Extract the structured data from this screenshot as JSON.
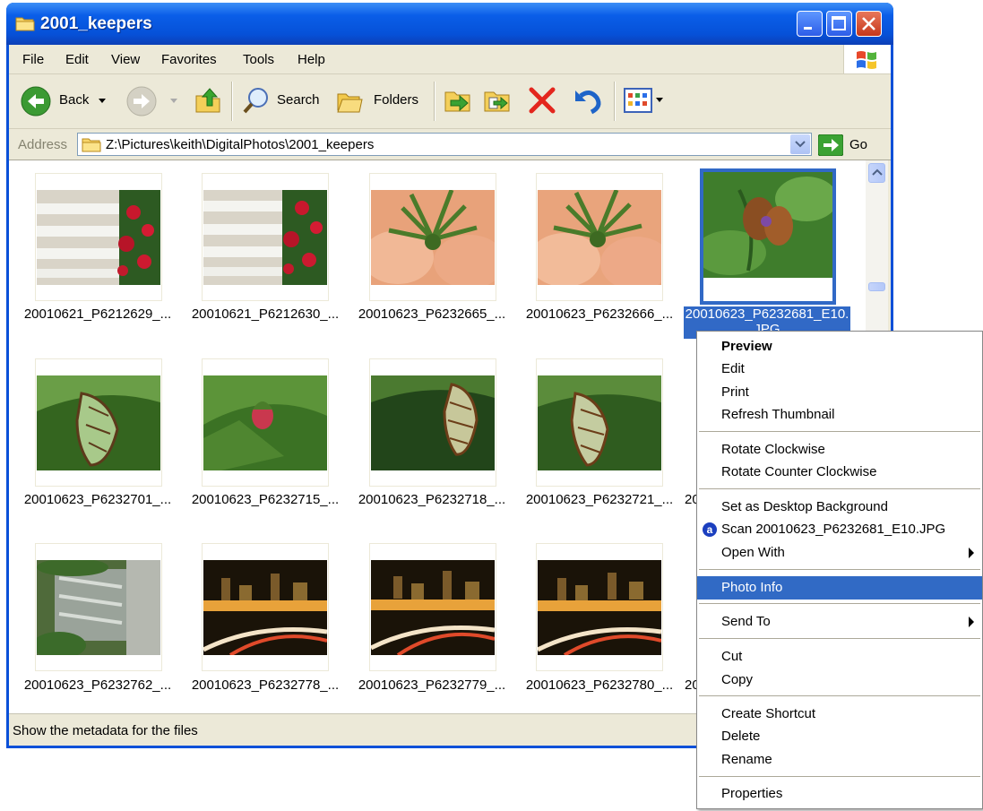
{
  "window": {
    "title": "2001_keepers",
    "title_icon": "folder-icon"
  },
  "menubar": {
    "items": [
      "File",
      "Edit",
      "View",
      "Favorites",
      "Tools",
      "Help"
    ]
  },
  "toolbar": {
    "back_label": "Back",
    "search_label": "Search",
    "folders_label": "Folders"
  },
  "addressbar": {
    "label": "Address",
    "path": "Z:\\Pictures\\keith\\DigitalPhotos\\2001_keepers",
    "go_label": "Go"
  },
  "thumbnails": [
    {
      "caption": "20010621_P6212629_...",
      "subject": "white fence with red flowers"
    },
    {
      "caption": "20010621_P6212630_...",
      "subject": "white fence with red flowers"
    },
    {
      "caption": "20010623_P6232665_...",
      "subject": "peach flower with green sepals"
    },
    {
      "caption": "20010623_P6232666_...",
      "subject": "peach flower with green sepals"
    },
    {
      "caption": "20010623_P6232681_E10.JPG",
      "subject": "butterfly on leaves",
      "selected": true
    },
    {
      "caption": "20010623_P6232701_...",
      "subject": "green butterfly under leaf"
    },
    {
      "caption": "20010623_P6232715_...",
      "subject": "pink flower bud"
    },
    {
      "caption": "20010623_P6232718_...",
      "subject": "green butterfly under leaf"
    },
    {
      "caption": "20010623_P6232721_...",
      "subject": "green butterfly under leaf"
    },
    {
      "caption": "20010623_P6232762_...",
      "subject": "garden waterfall"
    },
    {
      "caption": "20010623_P6232778_...",
      "subject": "city skyline at night"
    },
    {
      "caption": "20010623_P6232779_...",
      "subject": "city skyline at night"
    },
    {
      "caption": "20010623_P6232780_...",
      "subject": "city skyline at night"
    }
  ],
  "partial_captions": [
    "20",
    "20"
  ],
  "status": {
    "text": "Show the metadata for the files"
  },
  "context_menu": {
    "items": [
      {
        "label": "Preview",
        "bold": true
      },
      {
        "label": "Edit"
      },
      {
        "label": "Print"
      },
      {
        "label": "Refresh Thumbnail"
      },
      {
        "separator": true
      },
      {
        "label": "Rotate Clockwise"
      },
      {
        "label": "Rotate Counter Clockwise"
      },
      {
        "separator": true
      },
      {
        "label": "Set as Desktop Background"
      },
      {
        "label": "Scan 20010623_P6232681_E10.JPG",
        "icon": "antivirus-icon",
        "icon_glyph": "a"
      },
      {
        "label": "Open With",
        "submenu": true
      },
      {
        "separator": true
      },
      {
        "label": "Photo Info",
        "highlighted": true
      },
      {
        "separator": true
      },
      {
        "label": "Send To",
        "submenu": true
      },
      {
        "separator": true
      },
      {
        "label": "Cut"
      },
      {
        "label": "Copy"
      },
      {
        "separator": true
      },
      {
        "label": "Create Shortcut"
      },
      {
        "label": "Delete"
      },
      {
        "label": "Rename"
      },
      {
        "separator": true
      },
      {
        "label": "Properties"
      }
    ]
  },
  "colors": {
    "selection": "#316ac5",
    "titlebar": "#0a5ee8",
    "chrome": "#ece9d8"
  }
}
